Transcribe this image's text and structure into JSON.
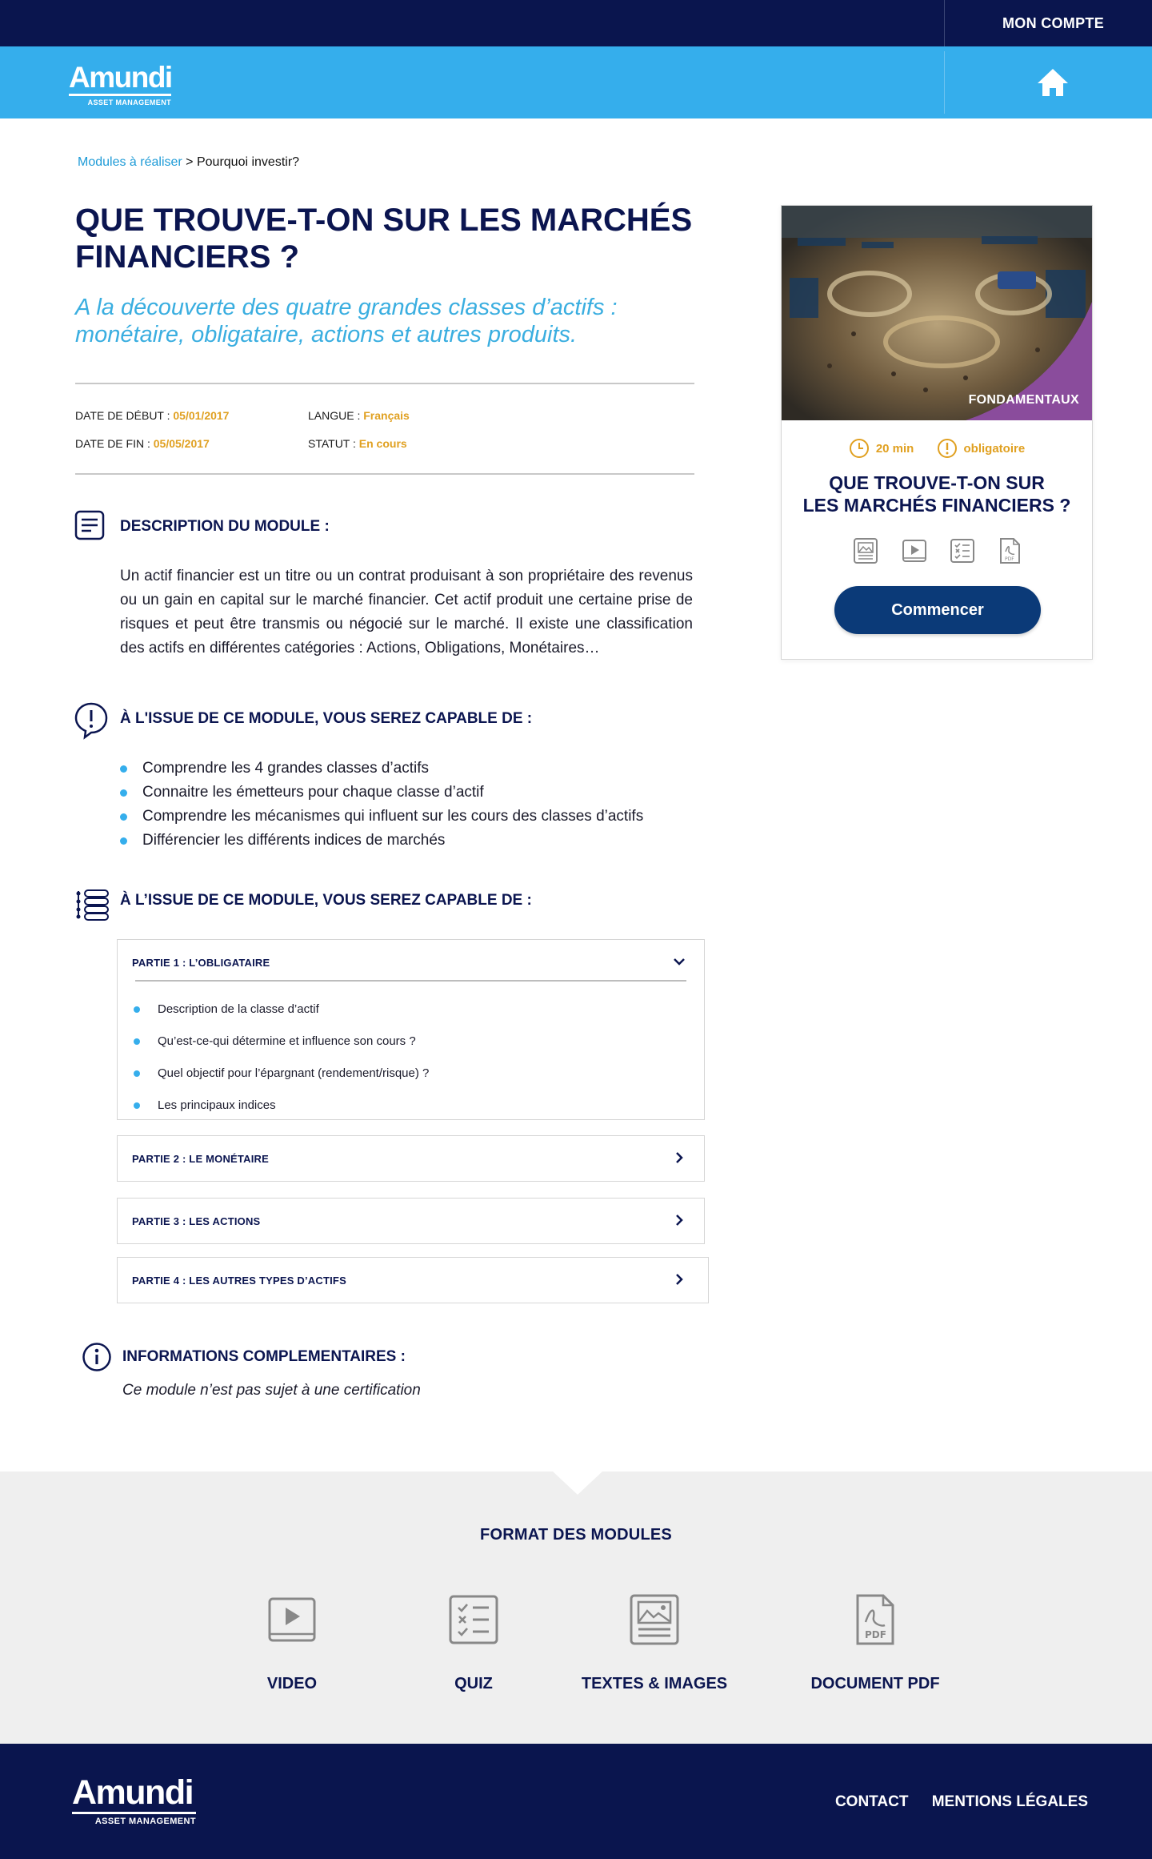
{
  "topbar": {
    "account_label": "MON COMPTE"
  },
  "brand": {
    "name": "Amundi",
    "tagline": "ASSET MANAGEMENT"
  },
  "breadcrumb": {
    "link": "Modules à réaliser",
    "separator": " > ",
    "current": "Pourquoi investir?"
  },
  "module": {
    "title": "QUE TROUVE-T-ON SUR LES MARCHÉS FINANCIERS ?",
    "subtitle": "A la découverte des quatre grandes classes d’actifs : monétaire, obligataire, actions et autres produits.",
    "meta": {
      "start_label": "DATE DE DÉBUT : ",
      "start_value": "05/01/2017",
      "end_label": "DATE DE FIN : ",
      "end_value": "05/05/2017",
      "lang_label": "LANGUE : ",
      "lang_value": "Français",
      "status_label": "STATUT : ",
      "status_value": "En cours"
    },
    "description_title": "DESCRIPTION DU MODULE :",
    "description": "Un actif financier est un titre ou un contrat produisant à son propriétaire des revenus ou un gain en capital sur le marché financier. Cet actif produit une certaine prise de risques et peut être transmis ou négocié sur le marché. Il existe une classification des actifs en différentes catégories : Actions, Obligations, Monétaires…",
    "objectives_title": "À L'ISSUE DE CE MODULE, VOUS SEREZ CAPABLE DE :",
    "objectives": [
      "Comprendre les 4 grandes classes d’actifs",
      "Connaitre les émetteurs pour chaque classe d’actif",
      "Comprendre les mécanismes qui influent sur les cours des classes d’actifs",
      "Différencier les différents indices de marchés"
    ],
    "program_title": "À L’ISSUE DE CE MODULE, VOUS SEREZ CAPABLE DE :",
    "parts": [
      {
        "label": "PARTIE 1 : L’OBLIGATAIRE",
        "expanded": true,
        "items": [
          "Description de la classe d’actif",
          "Qu’est-ce-qui détermine et influence son cours ?",
          "Quel objectif pour l’épargnant (rendement/risque) ?",
          "Les principaux indices"
        ]
      },
      {
        "label": "PARTIE 2 : LE MONÉTAIRE",
        "expanded": false
      },
      {
        "label": "PARTIE 3 : LES ACTIONS",
        "expanded": false
      },
      {
        "label": "PARTIE 4 : LES AUTRES TYPES D’ACTIFS",
        "expanded": false
      }
    ],
    "info_title": "INFORMATIONS COMPLEMENTAIRES :",
    "info_text": "Ce module n’est pas sujet à une certification"
  },
  "card": {
    "category": "FONDAMENTAUX",
    "duration": "20 min",
    "requirement": "obligatoire",
    "title_line1": "QUE TROUVE-T-ON SUR",
    "title_line2": "LES MARCHÉS FINANCIERS ?",
    "format_icons": [
      "text-image-icon",
      "video-icon",
      "quiz-icon",
      "pdf-icon"
    ],
    "cta": "Commencer"
  },
  "formats": {
    "title": "FORMAT DES MODULES",
    "items": [
      {
        "label": "VIDEO",
        "icon": "video-icon"
      },
      {
        "label": "QUIZ",
        "icon": "quiz-icon"
      },
      {
        "label": "TEXTES & IMAGES",
        "icon": "text-image-icon"
      },
      {
        "label": "DOCUMENT PDF",
        "icon": "pdf-icon"
      }
    ]
  },
  "footer": {
    "contact": "CONTACT",
    "legal": "MENTIONS LÉGALES"
  },
  "colors": {
    "navy": "#0a154e",
    "sky": "#35aeec",
    "accent": "#e0a020",
    "category_purple": "#8a4c9c",
    "button": "#0b3a78"
  }
}
